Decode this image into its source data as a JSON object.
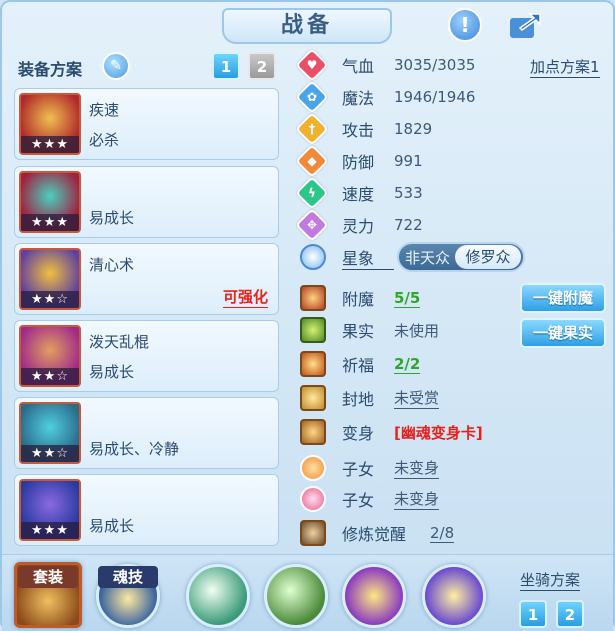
{
  "header": {
    "title": "战备"
  },
  "plan": {
    "label": "装备方案",
    "tabs": [
      "1",
      "2"
    ]
  },
  "equipment": [
    {
      "line1": "疾速",
      "line2": "必杀",
      "stars": "★★★",
      "tag": "",
      "color": "#b02a2a"
    },
    {
      "line1": "",
      "line2": "易成长",
      "stars": "★★★",
      "tag": "",
      "color": "#a02040"
    },
    {
      "line1": "清心术",
      "line2": "",
      "stars": "★★☆",
      "tag": "可强化",
      "color": "#6040a0"
    },
    {
      "line1": "泼天乱棍",
      "line2": "易成长",
      "stars": "★★☆",
      "tag": "",
      "color": "#a05a20"
    },
    {
      "line1": "",
      "line2": "易成长、冷静",
      "stars": "★★☆",
      "tag": "",
      "color": "#2a6a8a"
    },
    {
      "line1": "",
      "line2": "易成长",
      "stars": "★★★",
      "tag": "",
      "color": "#4a3aa0"
    }
  ],
  "attributes": [
    {
      "name": "气血",
      "value": "3035/3035",
      "icon": "heart-icon",
      "color": "#e8506a",
      "glyph": "♥"
    },
    {
      "name": "魔法",
      "value": "1946/1946",
      "icon": "mana-icon",
      "color": "#4aa6e8",
      "glyph": "✿"
    },
    {
      "name": "攻击",
      "value": "1829",
      "icon": "sword-icon",
      "color": "#f0b030",
      "glyph": "†"
    },
    {
      "name": "防御",
      "value": "991",
      "icon": "shield-icon",
      "color": "#f08a3a",
      "glyph": "◆"
    },
    {
      "name": "速度",
      "value": "533",
      "icon": "speed-icon",
      "color": "#2cc68a",
      "glyph": "ϟ"
    },
    {
      "name": "灵力",
      "value": "722",
      "icon": "spirit-icon",
      "color": "#c07ae0",
      "glyph": "✥"
    }
  ],
  "add_point": "加点方案1",
  "star_sign": {
    "label": "星象",
    "option_a": "非天众",
    "option_b": "修罗众"
  },
  "extras": [
    {
      "name": "附魔",
      "value": "5/5",
      "style": "green",
      "icon": "enchant-icon"
    },
    {
      "name": "果实",
      "value": "未使用",
      "style": "plain",
      "icon": "fruit-icon"
    },
    {
      "name": "祈福",
      "value": "2/2",
      "style": "green",
      "icon": "bless-icon"
    },
    {
      "name": "封地",
      "value": "未受赏",
      "style": "underline",
      "icon": "fief-icon"
    },
    {
      "name": "变身",
      "value": "[幽魂变身卡]",
      "style": "red",
      "icon": "transform-icon"
    },
    {
      "name": "子女",
      "value": "未变身",
      "style": "underline",
      "icon": "child-icon"
    },
    {
      "name": "子女",
      "value": "未变身",
      "style": "underline",
      "icon": "child-icon"
    },
    {
      "name": "修炼觉醒",
      "value": "2/8",
      "style": "underline",
      "icon": "cultivation-icon"
    }
  ],
  "actions": {
    "enchant": "一键附魔",
    "fruit": "一键果实"
  },
  "bottom": {
    "set_label": "套装",
    "soul_label": "魂技",
    "mount_label": "坐骑方案",
    "mount_tabs": [
      "1",
      "2"
    ]
  }
}
